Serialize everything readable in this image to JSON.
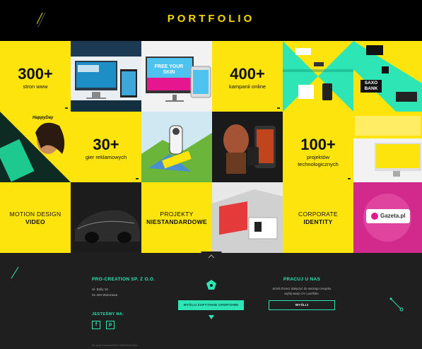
{
  "header": {
    "title": "PORTFOLIO"
  },
  "tiles": {
    "stat_sites": {
      "number": "300+",
      "label": "stron www"
    },
    "stat_campaigns": {
      "number": "400+",
      "label": "kampanii online"
    },
    "stat_games": {
      "number": "30+",
      "label": "gier reklamowych"
    },
    "stat_tech": {
      "number": "100+",
      "label_line1": "projektów",
      "label_line2": "technologicznych"
    },
    "cat_motion": {
      "line1": "MOTION DESIGN",
      "line2": "VIDEO"
    },
    "cat_projects": {
      "line1": "PROJEKTY",
      "line2": "NIESTANDARDOWE"
    },
    "cat_corporate": {
      "line1": "CORPORATE",
      "line2": "IDENTITY"
    }
  },
  "thumbs": {
    "web_banner_text": "FREE YOUR SKIN",
    "happyday_text": "HappyDay",
    "saxo_line1": "SAXO",
    "saxo_line2": "BANK",
    "gazeta_text": "Gazeta.pl"
  },
  "footer": {
    "company": "PRO-CREATION SP. Z O.O.",
    "address_line1": "Ul. Bully 18",
    "address_line2": "01-494 Warszawa",
    "social_heading": "JESTEŚMY NA:",
    "social": [
      "f",
      "p"
    ],
    "offer_button": "WYŚLIJ ZAPYTANIE OFERTOWE",
    "jobs_heading": "PRACUJ U NAS",
    "jobs_text_line1": "Jeżeli chcesz dołączyć do naszego zespołu,",
    "jobs_text_line2": "wyślij swoje CV i portfolio.",
    "send_button": "WYŚLIJ",
    "copyright": "All rights reserved PRO-CREATION 2014"
  },
  "colors": {
    "yellow": "#fde40d",
    "mint": "#2ee6b5",
    "dark": "#1f1f1f"
  }
}
